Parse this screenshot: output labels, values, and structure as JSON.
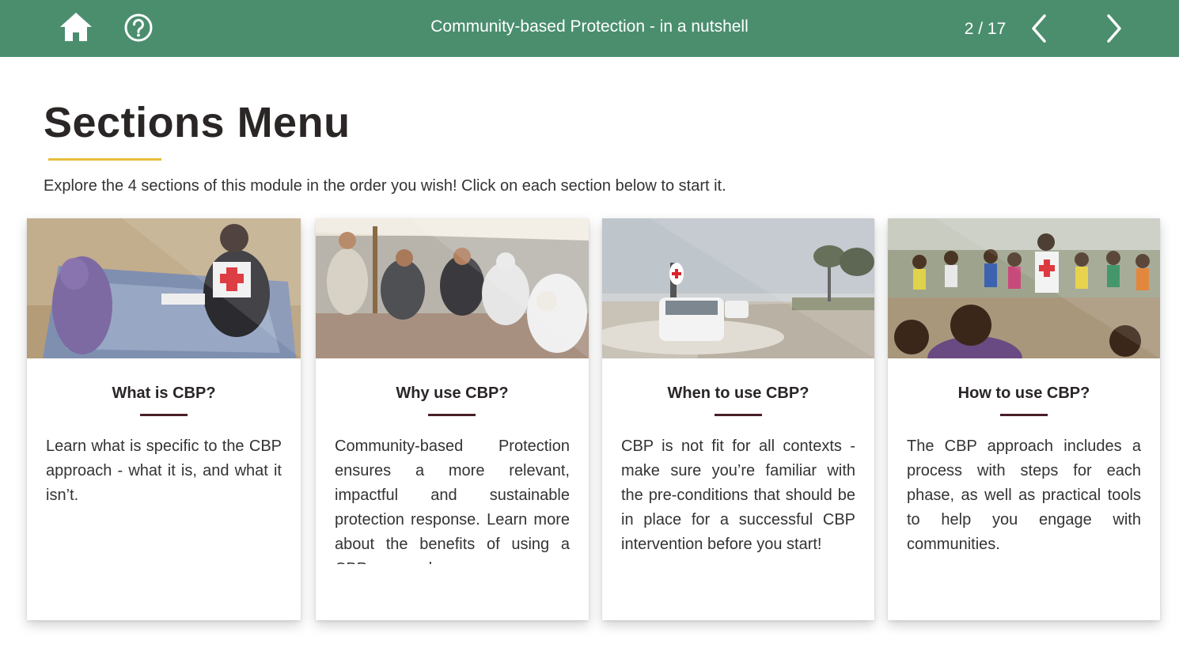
{
  "header": {
    "title": "Community-based Protection - in a nutshell",
    "page_counter": "2 / 17",
    "icons": [
      "home-icon",
      "help-icon",
      "chevron-left-icon",
      "chevron-right-icon"
    ],
    "background_color": "#4a8e6e"
  },
  "page": {
    "title": "Sections Menu",
    "intro_text": "Explore the 4 sections of this module in the order you wish! Click on each section below to start it.",
    "accent_color": "#e8bd3a"
  },
  "cards": [
    {
      "title": "What is CBP?",
      "text": "Learn what is specific to the CBP approach - what it is, and what it isn’t."
    },
    {
      "title": "Why use CBP?",
      "text": "Community-based Protection ensures a more relevant, impactful and sustainable protection response. Learn more about the benefits of using a CBP approach."
    },
    {
      "title": "When to use CBP?",
      "text": "CBP is not fit for all contexts - make sure you’re familiar with the pre-conditions that should be in place for a successful CBP intervention before you start!"
    },
    {
      "title": "How to use CBP?",
      "text": "The CBP approach includes a process with steps for each phase, as well as practical tools to help you engage with communities."
    }
  ]
}
